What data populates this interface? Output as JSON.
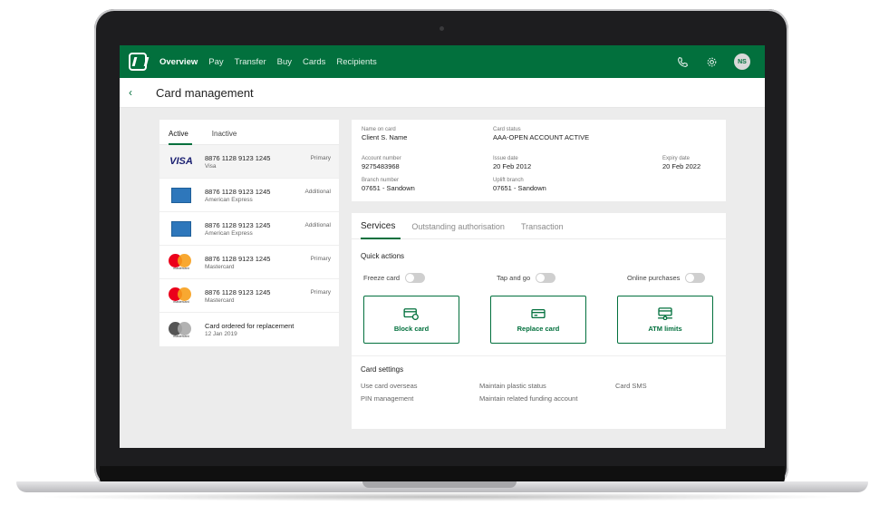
{
  "nav": {
    "items": [
      {
        "label": "Overview",
        "active": true
      },
      {
        "label": "Pay"
      },
      {
        "label": "Transfer"
      },
      {
        "label": "Buy"
      },
      {
        "label": "Cards"
      },
      {
        "label": "Recipients"
      }
    ],
    "avatar_initials": "NS",
    "brand_color": "#02703d"
  },
  "header": {
    "title": "Card management"
  },
  "cards_panel": {
    "tabs": [
      "Active",
      "Inactive"
    ],
    "cards": [
      {
        "number": "8876 1128 9123 1245",
        "type": "Visa",
        "tag": "Primary",
        "brand": "visa"
      },
      {
        "number": "8876 1128 9123 1245",
        "type": "American Express",
        "tag": "Additional",
        "brand": "amex"
      },
      {
        "number": "8876 1128 9123 1245",
        "type": "American Express",
        "tag": "Additional",
        "brand": "amex"
      },
      {
        "number": "8876 1128 9123 1245",
        "type": "Mastercard",
        "tag": "Primary",
        "brand": "mastercard"
      },
      {
        "number": "8876 1128 9123 1245",
        "type": "Mastercard",
        "tag": "Primary",
        "brand": "mastercard"
      },
      {
        "number": "Card ordered for replacement",
        "type": "12 Jan 2019",
        "tag": "",
        "brand": "mastercard-grey"
      }
    ],
    "visa_logo": "VISA",
    "mastercard_logo_text": "mastercard"
  },
  "card_info": {
    "name_label": "Name on card",
    "name_value": "Client S. Name",
    "status_label": "Card status",
    "status_value": "AAA-OPEN ACCOUNT ACTIVE",
    "account_label": "Account number",
    "account_value": "9275483968",
    "issue_label": "Issue date",
    "issue_value": "20 Feb 2012",
    "expiry_label": "Expiry date",
    "expiry_value": "20 Feb 2022",
    "branch_label": "Branch number",
    "branch_value": "07651 - Sandown",
    "uplift_label": "Uplift branch",
    "uplift_value": "07651 - Sandown"
  },
  "services": {
    "tabs": [
      "Services",
      "Outstanding authorisation",
      "Transaction"
    ],
    "quick_actions_title": "Quick actions",
    "toggles": [
      "Freeze card",
      "Tap and go",
      "Online purchases"
    ],
    "actions": [
      "Block card",
      "Replace card",
      "ATM limits"
    ],
    "settings_title": "Card settings",
    "settings": [
      "Use card overseas",
      "Maintain plastic status",
      "Card SMS",
      "PIN management",
      "Maintain related funding account"
    ]
  }
}
